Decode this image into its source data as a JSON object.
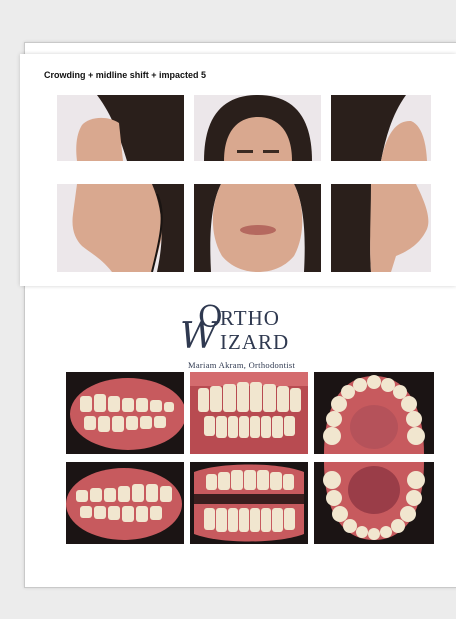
{
  "slide_top": {
    "title": "Crowding + midline shift + impacted 5"
  },
  "logo": {
    "letter_o": "O",
    "rest_top": "RTHO",
    "letter_w": "W",
    "rest_bottom": "IZARD",
    "subtitle": "Mariam Akram, Orthodontist"
  },
  "colors": {
    "background": "#ececec",
    "logo": "#2f3950",
    "skin": "#d9a88f",
    "hair": "#2a1f1b",
    "gum": "#c75a5e",
    "tooth": "#f1e6cf"
  }
}
